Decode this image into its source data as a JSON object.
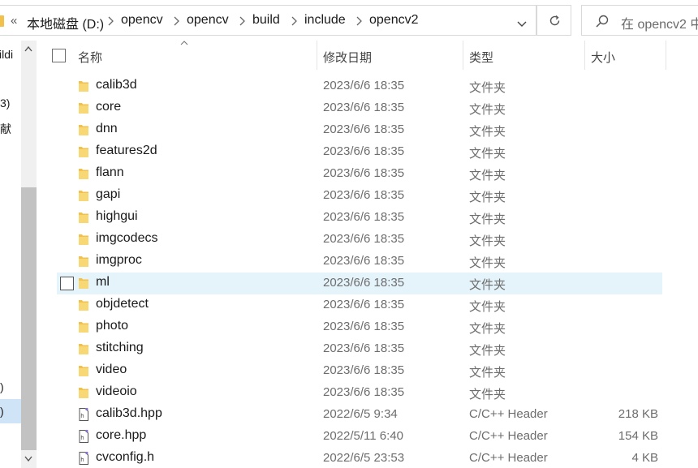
{
  "address_bar": {
    "overflow_chevron": "«",
    "breadcrumbs": [
      "本地磁盘 (D:)",
      "opencv",
      "opencv",
      "build",
      "include",
      "opencv2"
    ]
  },
  "search": {
    "placeholder": "在 opencv2 中"
  },
  "nav_pane": {
    "fragments": [
      "ildi",
      "3)",
      "献",
      ")",
      ")"
    ]
  },
  "columns": {
    "name": "名称",
    "modified": "修改日期",
    "type": "类型",
    "size": "大小"
  },
  "files": [
    {
      "name": "calib3d",
      "modified": "2023/6/6 18:35",
      "type": "文件夹",
      "size": "",
      "icon": "folder-icon"
    },
    {
      "name": "core",
      "modified": "2023/6/6 18:35",
      "type": "文件夹",
      "size": "",
      "icon": "folder-icon"
    },
    {
      "name": "dnn",
      "modified": "2023/6/6 18:35",
      "type": "文件夹",
      "size": "",
      "icon": "folder-icon"
    },
    {
      "name": "features2d",
      "modified": "2023/6/6 18:35",
      "type": "文件夹",
      "size": "",
      "icon": "folder-icon"
    },
    {
      "name": "flann",
      "modified": "2023/6/6 18:35",
      "type": "文件夹",
      "size": "",
      "icon": "folder-icon"
    },
    {
      "name": "gapi",
      "modified": "2023/6/6 18:35",
      "type": "文件夹",
      "size": "",
      "icon": "folder-icon"
    },
    {
      "name": "highgui",
      "modified": "2023/6/6 18:35",
      "type": "文件夹",
      "size": "",
      "icon": "folder-icon"
    },
    {
      "name": "imgcodecs",
      "modified": "2023/6/6 18:35",
      "type": "文件夹",
      "size": "",
      "icon": "folder-icon"
    },
    {
      "name": "imgproc",
      "modified": "2023/6/6 18:35",
      "type": "文件夹",
      "size": "",
      "icon": "folder-icon"
    },
    {
      "name": "ml",
      "modified": "2023/6/6 18:35",
      "type": "文件夹",
      "size": "",
      "icon": "folder-icon"
    },
    {
      "name": "objdetect",
      "modified": "2023/6/6 18:35",
      "type": "文件夹",
      "size": "",
      "icon": "folder-icon"
    },
    {
      "name": "photo",
      "modified": "2023/6/6 18:35",
      "type": "文件夹",
      "size": "",
      "icon": "folder-icon"
    },
    {
      "name": "stitching",
      "modified": "2023/6/6 18:35",
      "type": "文件夹",
      "size": "",
      "icon": "folder-icon"
    },
    {
      "name": "video",
      "modified": "2023/6/6 18:35",
      "type": "文件夹",
      "size": "",
      "icon": "folder-icon"
    },
    {
      "name": "videoio",
      "modified": "2023/6/6 18:35",
      "type": "文件夹",
      "size": "",
      "icon": "folder-icon"
    },
    {
      "name": "calib3d.hpp",
      "modified": "2022/6/5 9:34",
      "type": "C/C++ Header",
      "size": "218 KB",
      "icon": "header-file-icon"
    },
    {
      "name": "core.hpp",
      "modified": "2022/5/11 6:40",
      "type": "C/C++ Header",
      "size": "154 KB",
      "icon": "header-file-icon"
    },
    {
      "name": "cvconfig.h",
      "modified": "2022/6/5 23:53",
      "type": "C/C++ Header",
      "size": "4 KB",
      "icon": "header-file-icon"
    }
  ],
  "hovered_row": "ml",
  "colors": {
    "folder": "#f2c14b",
    "hover": "#e5f3fb",
    "nav_selected": "#cfe4f7",
    "scroll_thumb": "#c2c2c2"
  }
}
